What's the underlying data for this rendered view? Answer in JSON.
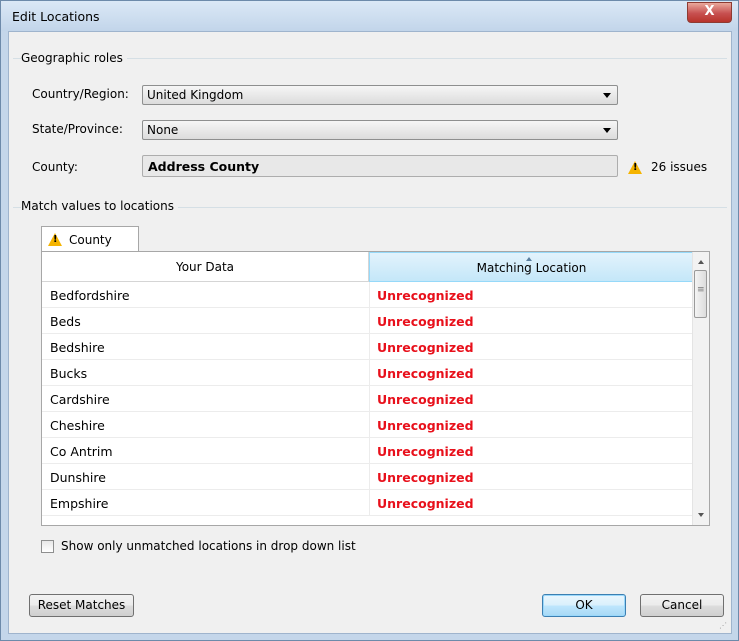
{
  "window": {
    "title": "Edit Locations",
    "close_label": "X"
  },
  "geographic_roles": {
    "group_title": "Geographic roles",
    "country": {
      "label": "Country/Region:",
      "value": "United Kingdom"
    },
    "state": {
      "label": "State/Province:",
      "value": "None"
    },
    "county": {
      "label": "County:",
      "value": "Address County",
      "issues": "26 issues"
    }
  },
  "match": {
    "group_title": "Match values to locations",
    "tab_label": "County",
    "columns": [
      "Your Data",
      "Matching Location"
    ],
    "rows": [
      {
        "data": "Bedfordshire",
        "match": "Unrecognized"
      },
      {
        "data": "Beds",
        "match": "Unrecognized"
      },
      {
        "data": "Bedshire",
        "match": "Unrecognized"
      },
      {
        "data": "Bucks",
        "match": "Unrecognized"
      },
      {
        "data": "Cardshire",
        "match": "Unrecognized"
      },
      {
        "data": "Cheshire",
        "match": "Unrecognized"
      },
      {
        "data": "Co Antrim",
        "match": "Unrecognized"
      },
      {
        "data": "Dunshire",
        "match": "Unrecognized"
      },
      {
        "data": "Empshire",
        "match": "Unrecognized"
      }
    ]
  },
  "show_unmatched_label": "Show only unmatched locations in drop down list",
  "buttons": {
    "reset": "Reset Matches",
    "ok": "OK",
    "cancel": "Cancel"
  },
  "colors": {
    "unrecognized": "#e8101b",
    "accent": "#c4e7f9",
    "warning": "#f5b400"
  }
}
